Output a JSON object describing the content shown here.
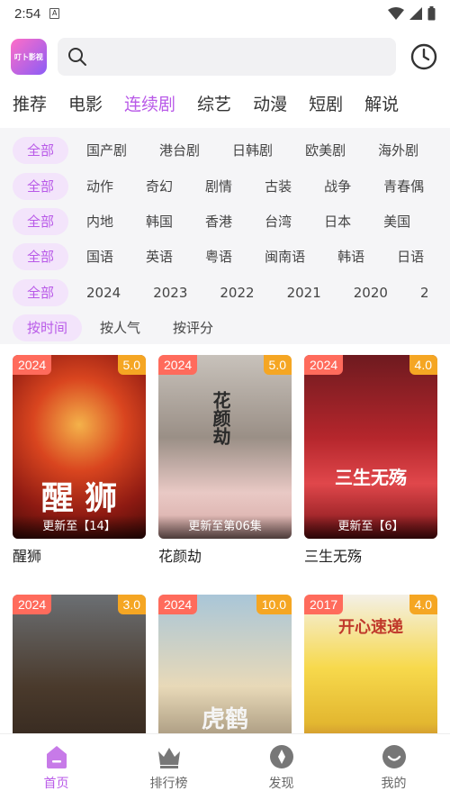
{
  "status": {
    "time": "2:54",
    "sim_label": "A"
  },
  "app": {
    "logo_text": "叮卜影视"
  },
  "search": {
    "placeholder": ""
  },
  "nav_tabs": [
    "推荐",
    "电影",
    "连续剧",
    "综艺",
    "动漫",
    "短剧",
    "解说"
  ],
  "active_tab": "连续剧",
  "filters": [
    [
      "全部",
      "国产剧",
      "港台剧",
      "日韩剧",
      "欧美剧",
      "海外剧"
    ],
    [
      "全部",
      "动作",
      "奇幻",
      "剧情",
      "古装",
      "战争",
      "青春偶"
    ],
    [
      "全部",
      "内地",
      "韩国",
      "香港",
      "台湾",
      "日本",
      "美国"
    ],
    [
      "全部",
      "国语",
      "英语",
      "粤语",
      "闽南语",
      "韩语",
      "日语"
    ],
    [
      "全部",
      "2024",
      "2023",
      "2022",
      "2021",
      "2020",
      "2"
    ],
    [
      "按时间",
      "按人气",
      "按评分"
    ]
  ],
  "cards": [
    {
      "year": "2024",
      "score": "5.0",
      "update": "更新至【14】",
      "title": "醒狮",
      "poster_text": "醒 狮"
    },
    {
      "year": "2024",
      "score": "5.0",
      "update": "更新至第06集",
      "title": "花颜劫",
      "poster_text": "花颜劫"
    },
    {
      "year": "2024",
      "score": "4.0",
      "update": "更新至【6】",
      "title": "三生无殇",
      "poster_text": "三生无殇"
    },
    {
      "year": "2024",
      "score": "3.0",
      "update": "",
      "title": "",
      "poster_text": ""
    },
    {
      "year": "2024",
      "score": "10.0",
      "update": "",
      "title": "",
      "poster_text": "虎鹤"
    },
    {
      "year": "2017",
      "score": "4.0",
      "update": "",
      "title": "",
      "poster_text": "开心速递"
    }
  ],
  "bottom_nav": [
    {
      "label": "首页",
      "icon": "home-icon"
    },
    {
      "label": "排行榜",
      "icon": "crown-icon"
    },
    {
      "label": "发现",
      "icon": "compass-icon"
    },
    {
      "label": "我的",
      "icon": "smile-icon"
    }
  ],
  "colors": {
    "accent": "#b95ae8",
    "year_badge": "#ff6b5c",
    "score_badge": "#f5a623"
  }
}
